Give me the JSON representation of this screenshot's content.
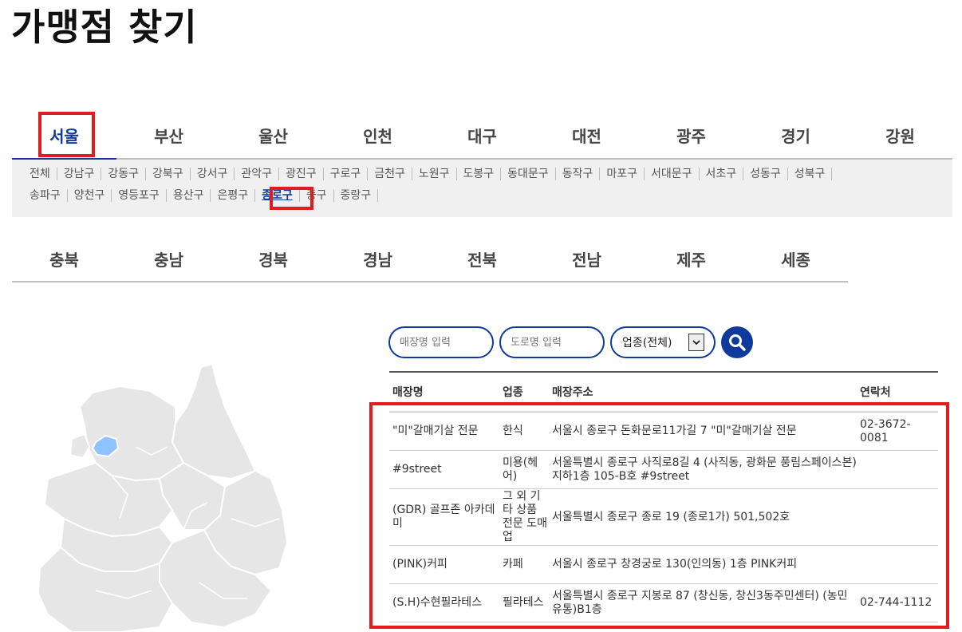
{
  "page": {
    "title": "가맹점 찾기"
  },
  "regions_row1": [
    {
      "label": "서울",
      "active": true
    },
    {
      "label": "부산"
    },
    {
      "label": "울산"
    },
    {
      "label": "인천"
    },
    {
      "label": "대구"
    },
    {
      "label": "대전"
    },
    {
      "label": "광주"
    },
    {
      "label": "경기"
    },
    {
      "label": "강원"
    }
  ],
  "districts_line1": [
    "전체",
    "강남구",
    "강동구",
    "강북구",
    "강서구",
    "관악구",
    "광진구",
    "구로구",
    "금천구",
    "노원구",
    "도봉구",
    "동대문구",
    "동작구",
    "마포구",
    "서대문구",
    "서초구",
    "성동구",
    "성북구"
  ],
  "districts_line2": [
    "송파구",
    "양천구",
    "영등포구",
    "용산구",
    "은평구",
    "종로구",
    "중구",
    "중랑구"
  ],
  "active_district": "종로구",
  "regions_row2": [
    {
      "label": "충북"
    },
    {
      "label": "충남"
    },
    {
      "label": "경북"
    },
    {
      "label": "경남"
    },
    {
      "label": "전북"
    },
    {
      "label": "전남"
    },
    {
      "label": "제주"
    },
    {
      "label": "세종"
    }
  ],
  "search": {
    "store_placeholder": "매장명 입력",
    "road_placeholder": "도로명 입력",
    "category_value": "업종(전체)"
  },
  "table": {
    "headers": {
      "name": "매장명",
      "category": "업종",
      "address": "매장주소",
      "phone": "연락처"
    },
    "rows": [
      {
        "name": "\"미\"갈매기살 전문",
        "category": "한식",
        "address": "서울시 종로구 돈화문로11가길 7 \"미\"갈매기살 전문",
        "phone": "02-3672-0081"
      },
      {
        "name": "#9street",
        "category": "미용(헤어)",
        "address": "서울특별시 종로구 사직로8길 4 (사직동, 광화문 풍림스페이스본) 지하1층 105-B호 #9street",
        "phone": ""
      },
      {
        "name": "(GDR) 골프존 아카데미",
        "category": "그 외 기타 상품 전문 도매업",
        "address": "서울특별시 종로구 종로 19 (종로1가) 501,502호",
        "phone": ""
      },
      {
        "name": "(PINK)커피",
        "category": "카페",
        "address": "서울시 종로구 창경궁로 130(인의동) 1층 PINK커피",
        "phone": ""
      },
      {
        "name": "(S.H)수현필라테스",
        "category": "필라테스",
        "address": "서울특별시 종로구 지봉로 87 (창신동, 창신3동주민센터) (농민유통)B1층",
        "phone": "02-744-1112"
      }
    ]
  },
  "colors": {
    "accent": "#0f3a9c",
    "highlight": "#e01b22",
    "map_fill": "#e6e6e6",
    "map_selected": "#8ec3ff"
  }
}
